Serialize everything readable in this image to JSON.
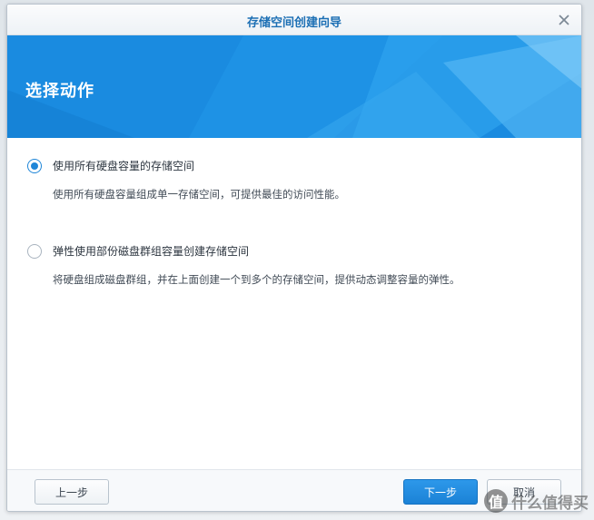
{
  "window": {
    "title": "存储空间创建向导"
  },
  "banner": {
    "heading": "选择动作"
  },
  "options": [
    {
      "label": "使用所有硬盘容量的存储空间",
      "description": "使用所有硬盘容量组成单一存储空间，可提供最佳的访问性能。",
      "selected": true
    },
    {
      "label": "弹性使用部份磁盘群组容量创建存储空间",
      "description": "将硬盘组成磁盘群组，并在上面创建一个到多个的存储空间，提供动态调整容量的弹性。",
      "selected": false
    }
  ],
  "footer": {
    "back_label": "上一步",
    "next_label": "下一步",
    "cancel_label": "取消"
  },
  "watermark": {
    "text": "什么值得买",
    "badge": "值"
  },
  "colors": {
    "accent": "#1a8be0",
    "title": "#1c6fb4"
  }
}
